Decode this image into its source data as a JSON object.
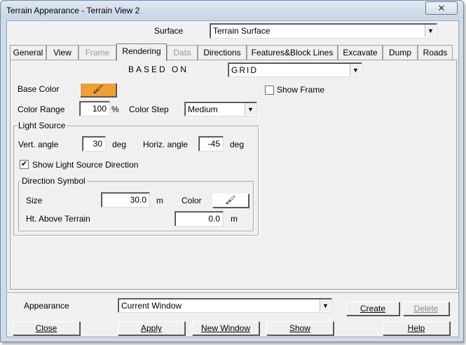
{
  "window": {
    "title": "Terrain Appearance - Terrain View 2",
    "close_glyph": "✕"
  },
  "surface": {
    "label": "Surface",
    "value": "Terrain Surface"
  },
  "tabs": [
    {
      "label": "General",
      "enabled": true
    },
    {
      "label": "View",
      "enabled": true
    },
    {
      "label": "Frame",
      "enabled": false
    },
    {
      "label": "Rendering",
      "enabled": true,
      "active": true
    },
    {
      "label": "Data",
      "enabled": false
    },
    {
      "label": "Directions",
      "enabled": true
    },
    {
      "label": "Features&Block Lines",
      "enabled": true
    },
    {
      "label": "Excavate",
      "enabled": true
    },
    {
      "label": "Dump",
      "enabled": true
    },
    {
      "label": "Roads",
      "enabled": true
    }
  ],
  "rendering": {
    "based_on_label": "BASED ON",
    "based_on_value": "GRID",
    "base_color_label": "Base Color",
    "base_color": "#f0a030",
    "show_frame_label": "Show Frame",
    "show_frame_checked": false,
    "color_range_label": "Color Range",
    "color_range_value": "100",
    "color_range_unit": "%",
    "color_step_label": "Color Step",
    "color_step_value": "Medium",
    "light_source": {
      "title": "Light Source",
      "vert_label": "Vert. angle",
      "vert_value": "30",
      "vert_unit": "deg",
      "horiz_label": "Horiz. angle",
      "horiz_value": "-45",
      "horiz_unit": "deg",
      "show_direction_label": "Show Light Source Direction",
      "show_direction_checked": true,
      "direction_symbol": {
        "title": "Direction Symbol",
        "size_label": "Size",
        "size_value": "30.0",
        "size_unit": "m",
        "color_label": "Color",
        "color": "#ffffff",
        "ht_label": "Ht. Above Terrain",
        "ht_value": "0.0",
        "ht_unit": "m"
      }
    }
  },
  "appearance": {
    "label": "Appearance",
    "value": "Current Window",
    "create_label": "Create",
    "delete_label": "Delete"
  },
  "buttons": {
    "close": "Close",
    "apply": "Apply",
    "new_window": "New Window",
    "show": "Show",
    "help": "Help"
  },
  "icons": {
    "color_picker": "palette-icon",
    "dropdown": "chevron-down-icon",
    "check_glyph": "✔",
    "arrow_glyph": "▼",
    "palette_glyph": "🖌"
  }
}
